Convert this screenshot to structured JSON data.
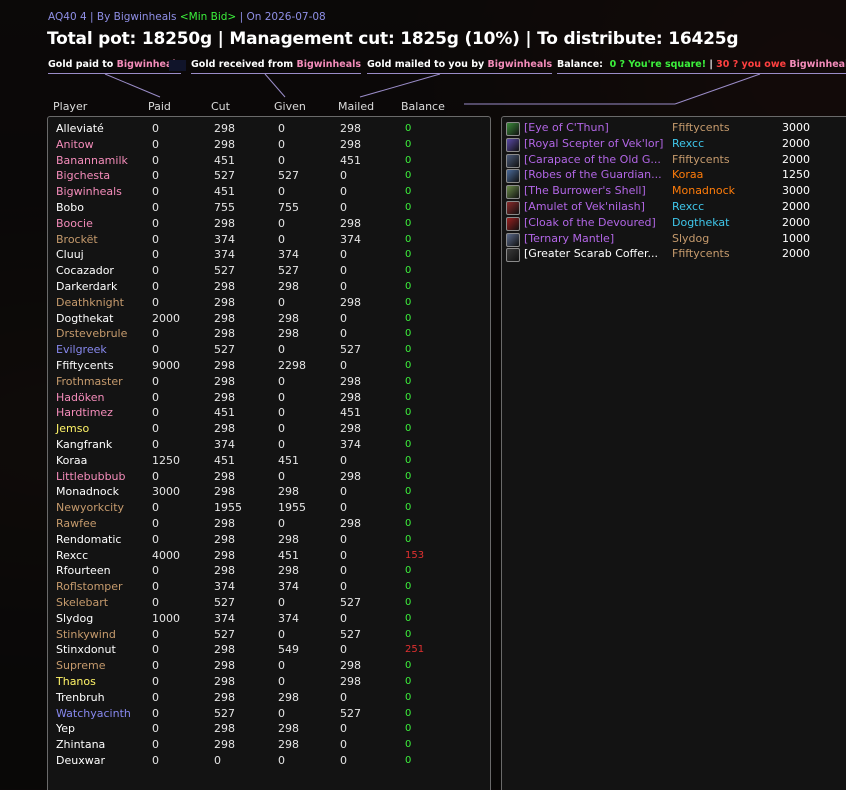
{
  "header": {
    "raid": "AQ40 4",
    "by_prefix": "By",
    "by_name": "Bigwinheals",
    "min_bid": "<Min Bid>",
    "date_prefix": "On",
    "date": "2026-07-08",
    "title": "Total pot: 18250g | Management cut: 1825g (10%) | To distribute: 16425g"
  },
  "legend": {
    "paid_text": "Gold paid to",
    "received_text": "Gold received from",
    "mailed_text": "Gold mailed to you by",
    "name": "Bigwinheals",
    "balance_label": "Balance:",
    "balance_square": "0 ? You're square!",
    "separator": "|",
    "balance_owe": "30 ? you owe",
    "balance_owe_name": "Bigwinheals",
    "balance_more": "30g"
  },
  "columns": [
    "Player",
    "Paid",
    "Cut",
    "Given",
    "Mailed",
    "Balance"
  ],
  "colors": {
    "priest": "#ffffff",
    "paladin": "#f48cba",
    "warrior": "#c69b6d",
    "warlock": "#8788ee",
    "rogue": "#fff468",
    "shaman": "#0070dd",
    "druid": "#ff7c0a",
    "mage": "#3fc7eb",
    "epic": "#b266e6"
  },
  "players": [
    {
      "name": "Alleviaté",
      "color": "#ffffff",
      "paid": "0",
      "cut": "298",
      "given": "0",
      "mailed": "298",
      "balance": "0"
    },
    {
      "name": "Anitow",
      "color": "#f48cba",
      "paid": "0",
      "cut": "298",
      "given": "0",
      "mailed": "298",
      "balance": "0"
    },
    {
      "name": "Banannamilk",
      "color": "#f48cba",
      "paid": "0",
      "cut": "451",
      "given": "0",
      "mailed": "451",
      "balance": "0"
    },
    {
      "name": "Bigchesta",
      "color": "#f48cba",
      "paid": "0",
      "cut": "527",
      "given": "527",
      "mailed": "0",
      "balance": "0"
    },
    {
      "name": "Bigwinheals",
      "color": "#f48cba",
      "paid": "0",
      "cut": "451",
      "given": "0",
      "mailed": "0",
      "balance": "0"
    },
    {
      "name": "Bobo",
      "color": "#ffffff",
      "paid": "0",
      "cut": "755",
      "given": "755",
      "mailed": "0",
      "balance": "0"
    },
    {
      "name": "Boocie",
      "color": "#f48cba",
      "paid": "0",
      "cut": "298",
      "given": "0",
      "mailed": "298",
      "balance": "0"
    },
    {
      "name": "Brockët",
      "color": "#c69b6d",
      "paid": "0",
      "cut": "374",
      "given": "0",
      "mailed": "374",
      "balance": "0"
    },
    {
      "name": "Cluuj",
      "color": "#ffffff",
      "paid": "0",
      "cut": "374",
      "given": "374",
      "mailed": "0",
      "balance": "0"
    },
    {
      "name": "Cocazador",
      "color": "#ffffff",
      "paid": "0",
      "cut": "527",
      "given": "527",
      "mailed": "0",
      "balance": "0"
    },
    {
      "name": "Darkerdark",
      "color": "#ffffff",
      "paid": "0",
      "cut": "298",
      "given": "298",
      "mailed": "0",
      "balance": "0"
    },
    {
      "name": "Deathknight",
      "color": "#c69b6d",
      "paid": "0",
      "cut": "298",
      "given": "0",
      "mailed": "298",
      "balance": "0"
    },
    {
      "name": "Dogthekat",
      "color": "#ffffff",
      "paid": "2000",
      "cut": "298",
      "given": "298",
      "mailed": "0",
      "balance": "0"
    },
    {
      "name": "Drstevebrule",
      "color": "#c69b6d",
      "paid": "0",
      "cut": "298",
      "given": "298",
      "mailed": "0",
      "balance": "0"
    },
    {
      "name": "Evilgreek",
      "color": "#8788ee",
      "paid": "0",
      "cut": "527",
      "given": "0",
      "mailed": "527",
      "balance": "0"
    },
    {
      "name": "Ffiftycents",
      "color": "#ffffff",
      "paid": "9000",
      "cut": "298",
      "given": "2298",
      "mailed": "0",
      "balance": "0"
    },
    {
      "name": "Frothmaster",
      "color": "#c69b6d",
      "paid": "0",
      "cut": "298",
      "given": "0",
      "mailed": "298",
      "balance": "0"
    },
    {
      "name": "Hadöken",
      "color": "#f48cba",
      "paid": "0",
      "cut": "298",
      "given": "0",
      "mailed": "298",
      "balance": "0"
    },
    {
      "name": "Hardtimez",
      "color": "#f48cba",
      "paid": "0",
      "cut": "451",
      "given": "0",
      "mailed": "451",
      "balance": "0"
    },
    {
      "name": "Jemso",
      "color": "#fff468",
      "paid": "0",
      "cut": "298",
      "given": "0",
      "mailed": "298",
      "balance": "0"
    },
    {
      "name": "Kangfrank",
      "color": "#ffffff",
      "paid": "0",
      "cut": "374",
      "given": "0",
      "mailed": "374",
      "balance": "0"
    },
    {
      "name": "Koraa",
      "color": "#ffffff",
      "paid": "1250",
      "cut": "451",
      "given": "451",
      "mailed": "0",
      "balance": "0"
    },
    {
      "name": "Littlebubbub",
      "color": "#f48cba",
      "paid": "0",
      "cut": "298",
      "given": "0",
      "mailed": "298",
      "balance": "0"
    },
    {
      "name": "Monadnock",
      "color": "#ffffff",
      "paid": "3000",
      "cut": "298",
      "given": "298",
      "mailed": "0",
      "balance": "0"
    },
    {
      "name": "Newyorkcity",
      "color": "#c69b6d",
      "paid": "0",
      "cut": "1955",
      "given": "1955",
      "mailed": "0",
      "balance": "0"
    },
    {
      "name": "Rawfee",
      "color": "#c69b6d",
      "paid": "0",
      "cut": "298",
      "given": "0",
      "mailed": "298",
      "balance": "0"
    },
    {
      "name": "Rendomatic",
      "color": "#ffffff",
      "paid": "0",
      "cut": "298",
      "given": "298",
      "mailed": "0",
      "balance": "0"
    },
    {
      "name": "Rexcc",
      "color": "#ffffff",
      "paid": "4000",
      "cut": "298",
      "given": "451",
      "mailed": "0",
      "balance": "153"
    },
    {
      "name": "Rfourteen",
      "color": "#ffffff",
      "paid": "0",
      "cut": "298",
      "given": "298",
      "mailed": "0",
      "balance": "0"
    },
    {
      "name": "Roflstomper",
      "color": "#c69b6d",
      "paid": "0",
      "cut": "374",
      "given": "374",
      "mailed": "0",
      "balance": "0"
    },
    {
      "name": "Skelebart",
      "color": "#c69b6d",
      "paid": "0",
      "cut": "527",
      "given": "0",
      "mailed": "527",
      "balance": "0"
    },
    {
      "name": "Slydog",
      "color": "#ffffff",
      "paid": "1000",
      "cut": "374",
      "given": "374",
      "mailed": "0",
      "balance": "0"
    },
    {
      "name": "Stinkywind",
      "color": "#c69b6d",
      "paid": "0",
      "cut": "527",
      "given": "0",
      "mailed": "527",
      "balance": "0"
    },
    {
      "name": "Stinxdonut",
      "color": "#ffffff",
      "paid": "0",
      "cut": "298",
      "given": "549",
      "mailed": "0",
      "balance": "251"
    },
    {
      "name": "Supreme",
      "color": "#c69b6d",
      "paid": "0",
      "cut": "298",
      "given": "0",
      "mailed": "298",
      "balance": "0"
    },
    {
      "name": "Thanos",
      "color": "#fff468",
      "paid": "0",
      "cut": "298",
      "given": "0",
      "mailed": "298",
      "balance": "0"
    },
    {
      "name": "Trenbruh",
      "color": "#ffffff",
      "paid": "0",
      "cut": "298",
      "given": "298",
      "mailed": "0",
      "balance": "0"
    },
    {
      "name": "Watchyacinth",
      "color": "#8788ee",
      "paid": "0",
      "cut": "527",
      "given": "0",
      "mailed": "527",
      "balance": "0"
    },
    {
      "name": "Yep",
      "color": "#ffffff",
      "paid": "0",
      "cut": "298",
      "given": "298",
      "mailed": "0",
      "balance": "0"
    },
    {
      "name": "Zhintana",
      "color": "#ffffff",
      "paid": "0",
      "cut": "298",
      "given": "298",
      "mailed": "0",
      "balance": "0"
    },
    {
      "name": "Deuxwar",
      "color": "#ffffff",
      "paid": "0",
      "cut": "0",
      "given": "0",
      "mailed": "0",
      "balance": "0"
    }
  ],
  "items": [
    {
      "name": "[Eye of C'Thun]",
      "quality": "epic",
      "winner": "Ffiftycents",
      "winner_color": "#c69b6d",
      "bid": "3000",
      "icon": "eye-icon",
      "icon_color": "#3a8a3a"
    },
    {
      "name": "[Royal Scepter of Vek'lor]",
      "quality": "epic",
      "winner": "Rexcc",
      "winner_color": "#3fc7eb",
      "bid": "2000",
      "icon": "scepter-icon",
      "icon_color": "#5a4aa8"
    },
    {
      "name": "[Carapace of the Old G...",
      "quality": "epic",
      "winner": "Ffiftycents",
      "winner_color": "#c69b6d",
      "bid": "2000",
      "icon": "carapace-icon",
      "icon_color": "#4a5a7a"
    },
    {
      "name": "[Robes of the Guardian...",
      "quality": "epic",
      "winner": "Koraa",
      "winner_color": "#ff7c0a",
      "bid": "1250",
      "icon": "robes-icon",
      "icon_color": "#4a6a9a"
    },
    {
      "name": "[The Burrower's Shell]",
      "quality": "epic",
      "winner": "Monadnock",
      "winner_color": "#ff7c0a",
      "bid": "3000",
      "icon": "shell-icon",
      "icon_color": "#6a8a4a"
    },
    {
      "name": "[Amulet of Vek'nilash]",
      "quality": "epic",
      "winner": "Rexcc",
      "winner_color": "#3fc7eb",
      "bid": "2000",
      "icon": "amulet-icon",
      "icon_color": "#8a2a2a"
    },
    {
      "name": "[Cloak of the Devoured]",
      "quality": "epic",
      "winner": "Dogthekat",
      "winner_color": "#3fc7eb",
      "bid": "2000",
      "icon": "cloak-icon",
      "icon_color": "#9a2020"
    },
    {
      "name": "[Ternary Mantle]",
      "quality": "epic",
      "winner": "Slydog",
      "winner_color": "#c69b6d",
      "bid": "1000",
      "icon": "mantle-icon",
      "icon_color": "#5a6a8a"
    },
    {
      "name": "[Greater Scarab Coffer...",
      "quality": "common",
      "winner": "Ffiftycents",
      "winner_color": "#c69b6d",
      "bid": "2000",
      "icon": "coffer-icon",
      "icon_color": "#3a3a3a"
    }
  ]
}
